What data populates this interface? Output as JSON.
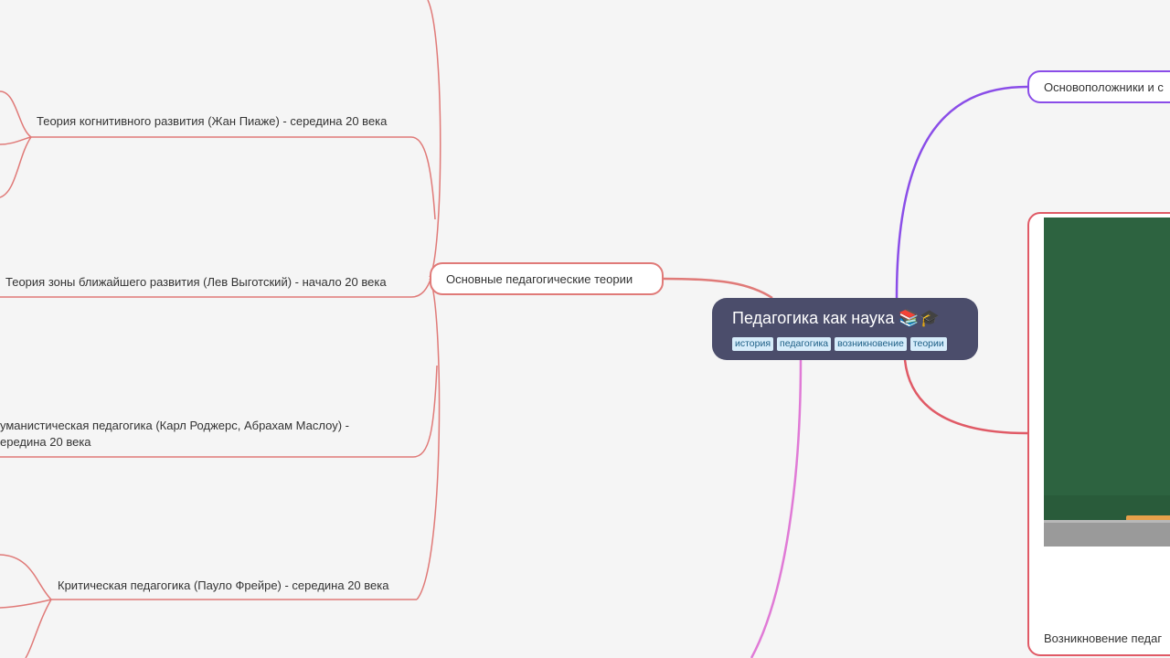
{
  "central": {
    "title": "Педагогика как наука 📚🎓",
    "tags": [
      "история",
      "педагогика",
      "возникновение",
      "теории"
    ]
  },
  "branches": {
    "theories": {
      "label": "Основные педагогические теории",
      "color": "#e07a78",
      "children": [
        "Теория когнитивного развития (Жан Пиаже) - середина 20 века",
        "Теория зоны ближайшего развития (Лев Выготский) - начало 20 века",
        "уманистическая педагогика (Карл Роджерс, Абрахам Маслоу) -",
        "ередина 20 века",
        "Критическая педагогика (Пауло Фрейре) - середина 20 века"
      ]
    },
    "founders": {
      "label": "Основоположники и с",
      "color": "#8a4de8"
    },
    "image_node": {
      "caption": "Возникновение педаг",
      "color": "#e05a66"
    },
    "bottom_link_color": "#e07ad6"
  }
}
